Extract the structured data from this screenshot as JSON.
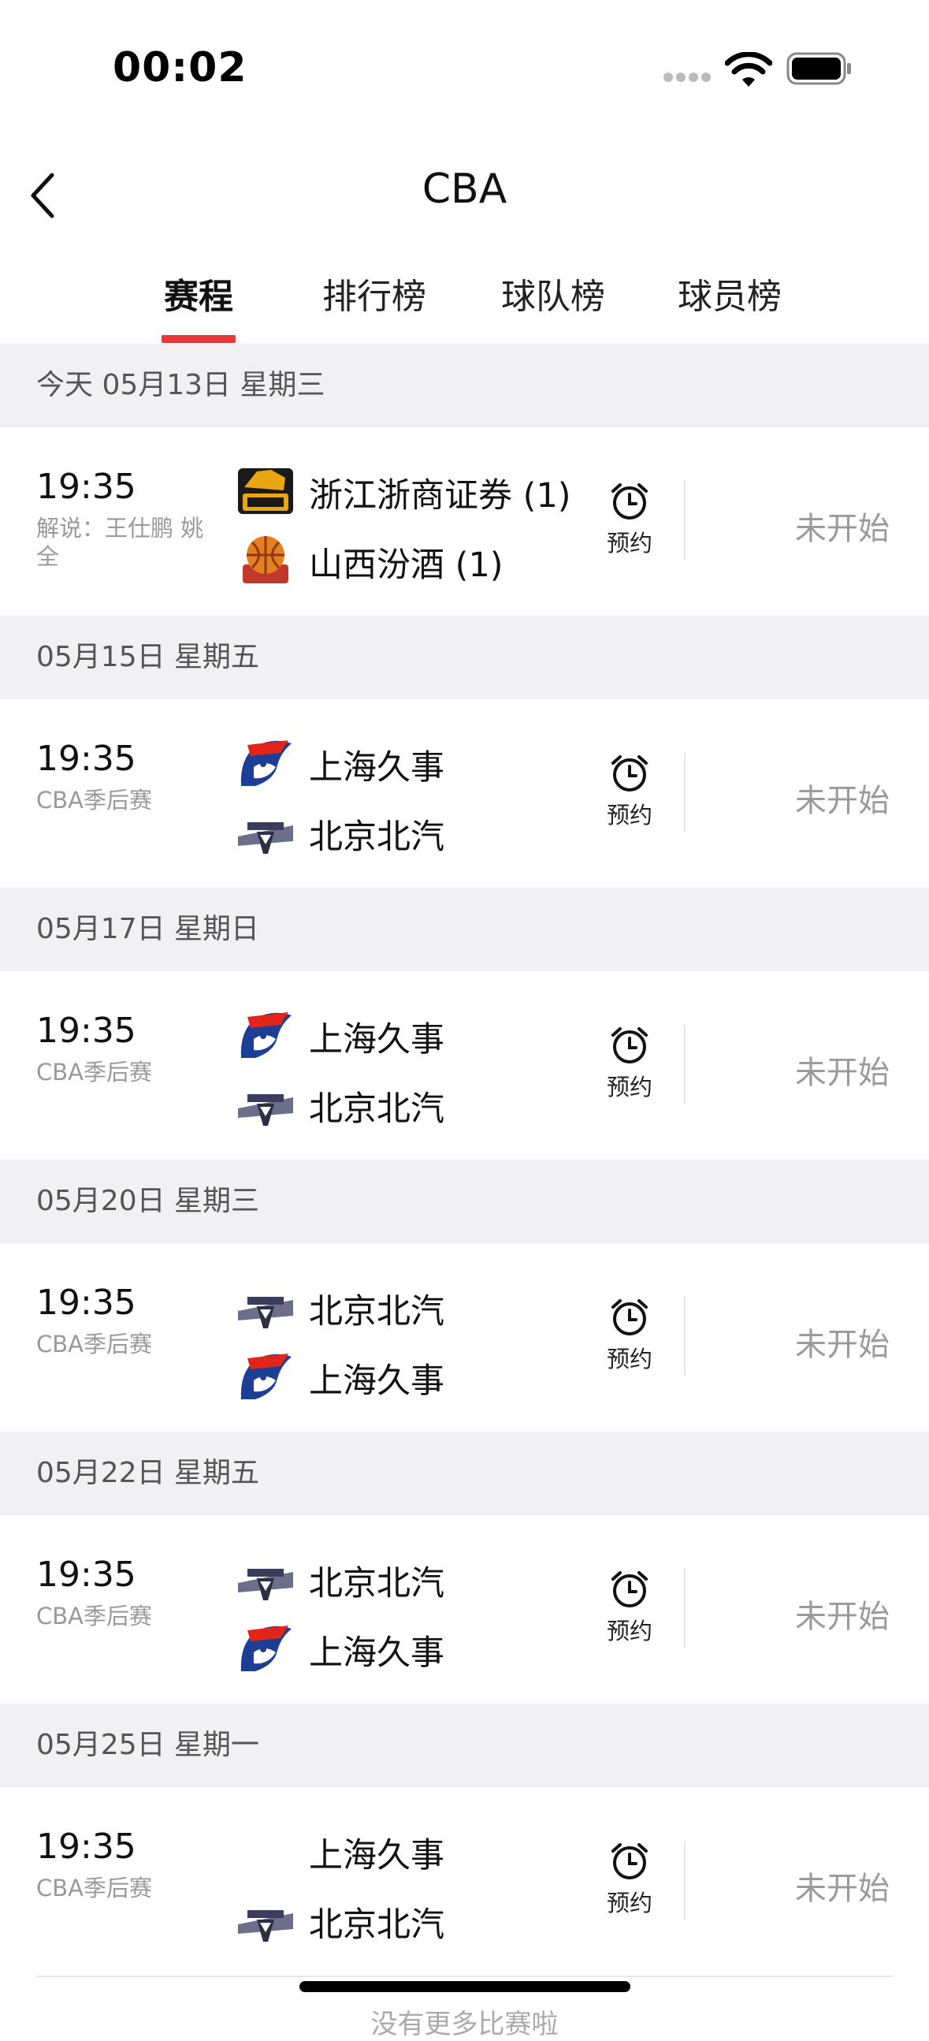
{
  "status_bar": {
    "time": "00:02"
  },
  "nav": {
    "title": "CBA",
    "back_icon": "chevron-left-icon"
  },
  "tabs": [
    {
      "label": "赛程",
      "active": true
    },
    {
      "label": "排行榜",
      "active": false
    },
    {
      "label": "球队榜",
      "active": false
    },
    {
      "label": "球员榜",
      "active": false
    }
  ],
  "colors": {
    "accent": "#e8383d",
    "header_bg": "#f1f1f3",
    "muted": "#9a9a9a"
  },
  "groups": [
    {
      "date": "今天 05月13日 星期三",
      "match": {
        "time": "19:35",
        "sub": "解说：王仕鹏 姚全",
        "team1": {
          "name": "浙江浙商证券 (1)",
          "logo": "zhejiang-logo"
        },
        "team2": {
          "name": "山西汾酒 (1)",
          "logo": "shanxi-logo"
        },
        "reminder": "预约",
        "status": "未开始"
      }
    },
    {
      "date": "05月15日 星期五",
      "match": {
        "time": "19:35",
        "sub": "CBA季后赛",
        "team1": {
          "name": "上海久事",
          "logo": "sharks-logo"
        },
        "team2": {
          "name": "北京北汽",
          "logo": "ducks-logo"
        },
        "reminder": "预约",
        "status": "未开始"
      }
    },
    {
      "date": "05月17日 星期日",
      "match": {
        "time": "19:35",
        "sub": "CBA季后赛",
        "team1": {
          "name": "上海久事",
          "logo": "sharks-logo"
        },
        "team2": {
          "name": "北京北汽",
          "logo": "ducks-logo"
        },
        "reminder": "预约",
        "status": "未开始"
      }
    },
    {
      "date": "05月20日 星期三",
      "match": {
        "time": "19:35",
        "sub": "CBA季后赛",
        "team1": {
          "name": "北京北汽",
          "logo": "ducks-logo"
        },
        "team2": {
          "name": "上海久事",
          "logo": "sharks-logo"
        },
        "reminder": "预约",
        "status": "未开始"
      }
    },
    {
      "date": "05月22日 星期五",
      "match": {
        "time": "19:35",
        "sub": "CBA季后赛",
        "team1": {
          "name": "北京北汽",
          "logo": "ducks-logo"
        },
        "team2": {
          "name": "上海久事",
          "logo": "sharks-logo"
        },
        "reminder": "预约",
        "status": "未开始"
      }
    },
    {
      "date": "05月25日 星期一",
      "match": {
        "time": "19:35",
        "sub": "CBA季后赛",
        "team1": {
          "name": "上海久事",
          "logo": ""
        },
        "team2": {
          "name": "北京北汽",
          "logo": "ducks-logo"
        },
        "reminder": "预约",
        "status": "未开始"
      }
    }
  ],
  "footer": {
    "text": "没有更多比赛啦"
  }
}
